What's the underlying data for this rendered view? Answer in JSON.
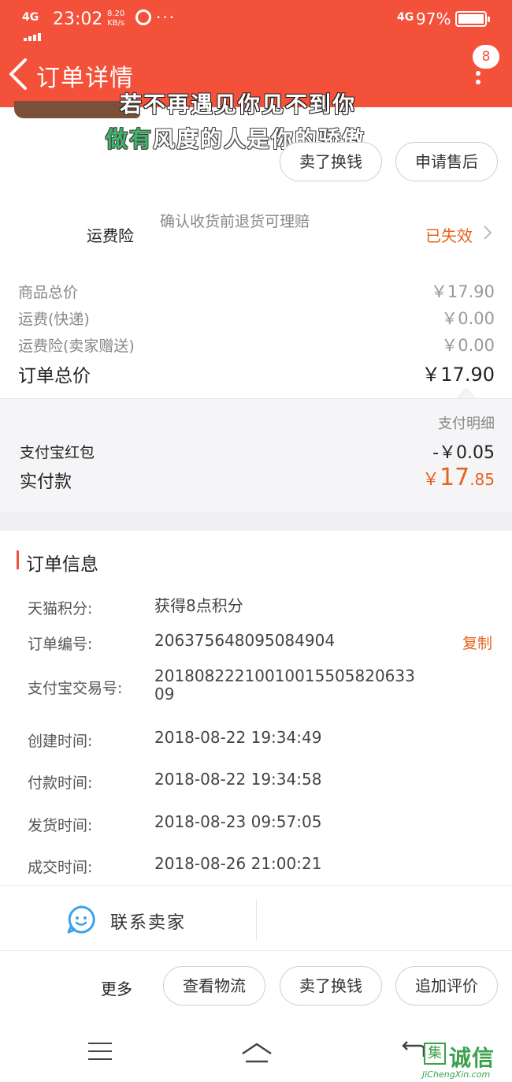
{
  "status_bar": {
    "network": "4G",
    "time": "23:02",
    "speed_value": "8.20",
    "speed_unit": "KB/s",
    "more": "···",
    "net_right": "4G",
    "battery": "97%"
  },
  "header": {
    "title": "订单详情",
    "badge": "8",
    "accent": "#f4513a"
  },
  "overlay": {
    "line1": "若不再遇见你见不到你",
    "line2_green": "做有",
    "line2_rest": "风度的人是你的骄傲"
  },
  "top_actions": {
    "sell_label": "卖了换钱",
    "aftersale_label": "申请售后"
  },
  "insurance": {
    "label": "运费险",
    "desc": "确认收货前退货可理赔",
    "status": "已失效",
    "status_color": "#e5631f"
  },
  "prices": {
    "rows": [
      {
        "label": "商品总价",
        "value": "￥17.90"
      },
      {
        "label": "运费(快递)",
        "value": "￥0.00"
      },
      {
        "label": "运费险(卖家赠送)",
        "value": "￥0.00"
      }
    ],
    "total_label": "订单总价",
    "total_value": "￥17.90"
  },
  "payment": {
    "detail_link": "支付明细",
    "hongbao_label": "支付宝红包",
    "hongbao_value": "-￥0.05",
    "paid_label": "实付款",
    "paid_currency": "￥",
    "paid_int": "17",
    "paid_dec": ".85"
  },
  "order_info": {
    "title": "订单信息",
    "copy_label": "复制",
    "rows": [
      {
        "label": "天猫积分:",
        "value": "获得8点积分"
      },
      {
        "label": "订单编号:",
        "value": "206375648095084904"
      },
      {
        "label": "支付宝交易号:",
        "value": "20180822210010015505820633",
        "value2": "09"
      },
      {
        "label": "创建时间:",
        "value": "2018-08-22 19:34:49"
      },
      {
        "label": "付款时间:",
        "value": "2018-08-22 19:34:58"
      },
      {
        "label": "发货时间:",
        "value": "2018-08-23 09:57:05"
      },
      {
        "label": "成交时间:",
        "value": "2018-08-26 21:00:21"
      }
    ]
  },
  "contact": {
    "label": "联系卖家",
    "icon": "chat-face-icon"
  },
  "bottom_actions": {
    "more_label": "更多",
    "logistics_label": "查看物流",
    "sell_label": "卖了换钱",
    "review_label": "追加评价"
  },
  "watermark": {
    "box_char": "集",
    "chars": "诚信",
    "url": "JiChengXin.com"
  }
}
